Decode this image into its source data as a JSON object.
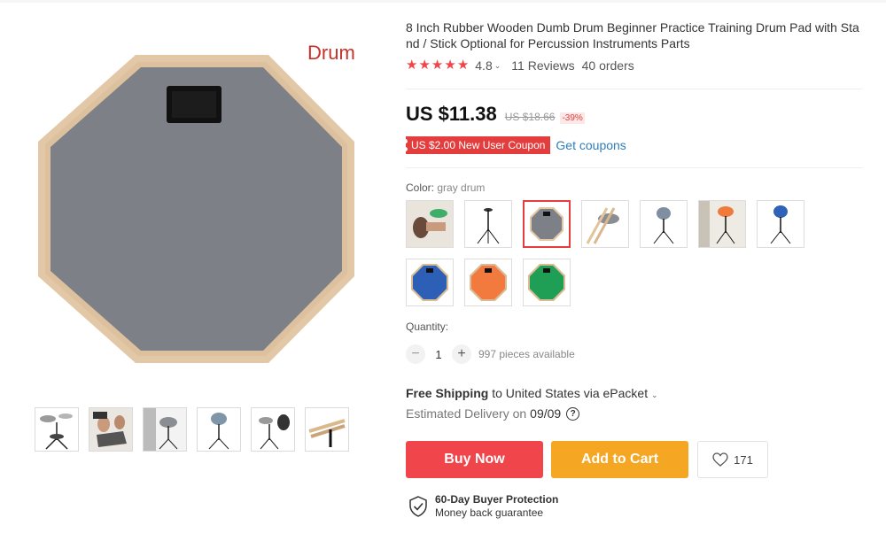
{
  "product": {
    "title": "8 Inch Rubber Wooden Dumb Drum Beginner Practice Training Drum Pad with Stand / Stick Optional for Percussion Instruments Parts",
    "image_caption": "Drum"
  },
  "rating": {
    "value": "4.8",
    "stars": 5,
    "reviews": "11 Reviews",
    "orders": "40 orders"
  },
  "price": {
    "current": "US $11.38",
    "original": "US $18.66",
    "discount": "-39%"
  },
  "coupon": {
    "label": "US $2.00 New User Coupon",
    "link": "Get coupons"
  },
  "color": {
    "label": "Color: ",
    "selected": "gray drum",
    "options": [
      "hands with drum",
      "stand",
      "gray drum",
      "drum sticks",
      "gray drum with stand",
      "orange drum with stand",
      "blue drum with stand",
      "blue drum",
      "orange drum",
      "green drum"
    ]
  },
  "quantity": {
    "label": "Quantity:",
    "value": "1",
    "available": "997 pieces available"
  },
  "shipping": {
    "free_label": "Free Shipping",
    "destination": " to United States via ePacket",
    "est_label": "Estimated Delivery on",
    "est_date": "09/09"
  },
  "actions": {
    "buy_now": "Buy Now",
    "add_to_cart": "Add to Cart",
    "wishlist_count": "171"
  },
  "protection": {
    "title": "60-Day Buyer Protection",
    "subtitle": "Money back guarantee"
  },
  "colors": {
    "accent_red": "#f0464b",
    "cart_orange": "#f5a623",
    "link_blue": "#2f7dbb",
    "drum_gray": "#7d8187",
    "wood": "#e2c8a6"
  }
}
